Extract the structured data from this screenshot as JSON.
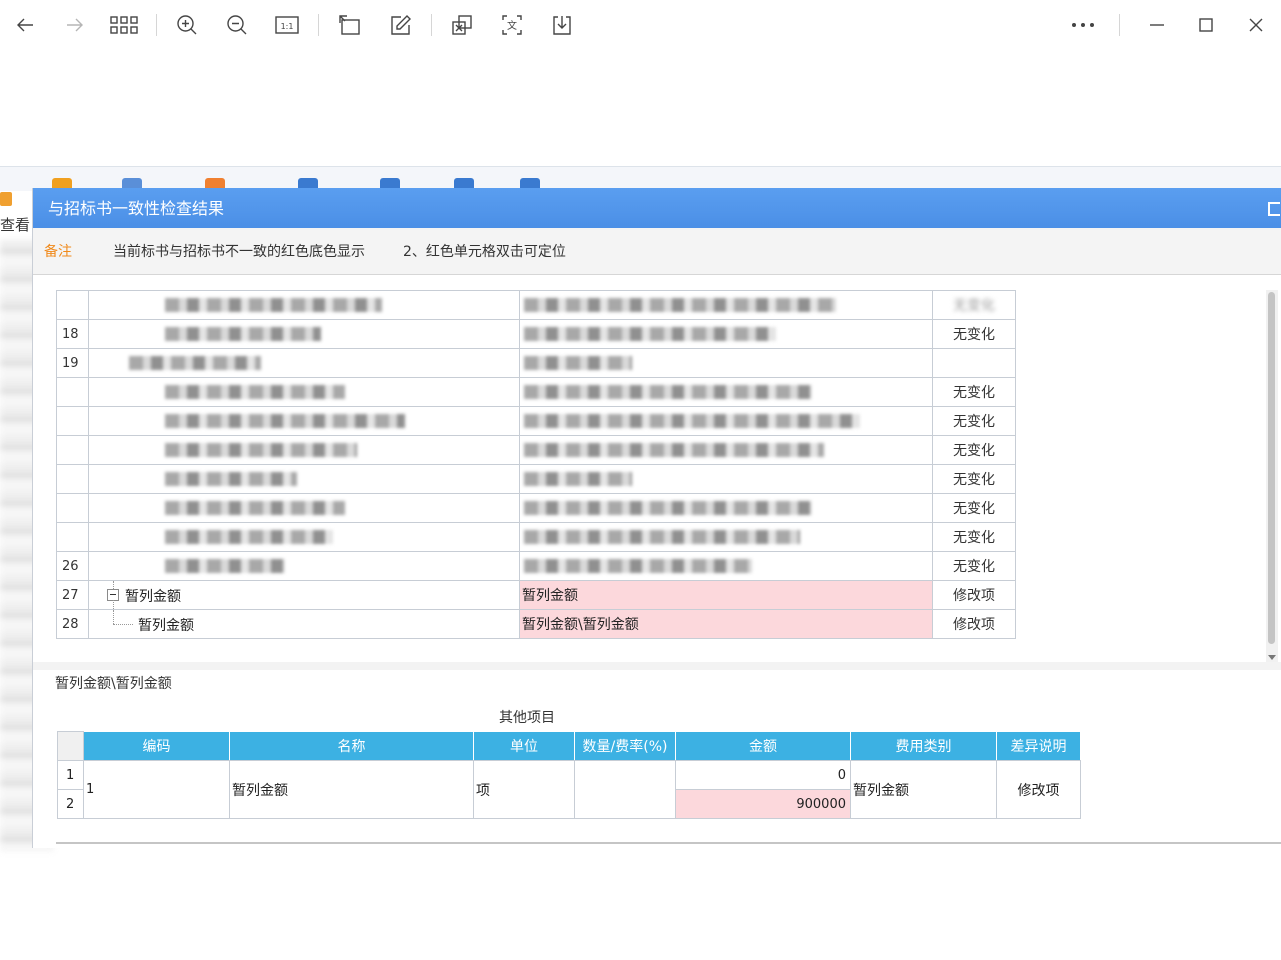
{
  "viewer": {
    "toolbar": [
      {
        "name": "back-button",
        "icon": "arrow-left-icon"
      },
      {
        "name": "forward-button",
        "icon": "arrow-right-icon"
      },
      {
        "name": "grid-view-button",
        "icon": "grid-icon"
      },
      {
        "name": "zoom-in-button",
        "icon": "zoom-in-icon"
      },
      {
        "name": "zoom-out-button",
        "icon": "zoom-out-icon"
      },
      {
        "name": "actual-size-button",
        "icon": "actual-size-icon",
        "text": "1:1"
      },
      {
        "name": "rotate-button",
        "icon": "rotate-icon"
      },
      {
        "name": "edit-button",
        "icon": "edit-icon"
      },
      {
        "name": "copy-button",
        "icon": "copy-icon"
      },
      {
        "name": "ocr-button",
        "icon": "ocr-icon",
        "text": "文"
      },
      {
        "name": "save-button",
        "icon": "download-icon"
      },
      {
        "name": "more-button",
        "icon": "more-icon"
      },
      {
        "name": "minimize-button",
        "icon": "minimize-icon"
      },
      {
        "name": "maximize-button",
        "icon": "maximize-icon"
      },
      {
        "name": "close-button",
        "icon": "close-icon"
      }
    ]
  },
  "app": {
    "left_label": "查看"
  },
  "dialog": {
    "title": "与招标书一致性检查结果",
    "note_label": "备注",
    "note_text_1": "当前标书与招标书不一致的红色底色显示",
    "note_text_2": "2、红色单元格双击可定位",
    "accent_color": "#4b8fe6",
    "highlight_color": "#fcd8dc"
  },
  "upper_grid": {
    "rows": [
      {
        "num": "",
        "col1": "",
        "col2": "",
        "status": "无变化",
        "blurred": true,
        "status_blurred": true
      },
      {
        "num": "18",
        "col1": "",
        "col2": "",
        "status": "无变化",
        "blurred": true
      },
      {
        "num": "19",
        "col1": "",
        "col2": "",
        "status": "",
        "blurred": true,
        "status_blurred": true
      },
      {
        "num": "",
        "col1": "",
        "col2": "",
        "status": "无变化",
        "blurred": true
      },
      {
        "num": "",
        "col1": "",
        "col2": "",
        "status": "无变化",
        "blurred": true
      },
      {
        "num": "",
        "col1": "",
        "col2": "",
        "status": "无变化",
        "blurred": true
      },
      {
        "num": "",
        "col1": "",
        "col2": "",
        "status": "无变化",
        "blurred": true
      },
      {
        "num": "",
        "col1": "",
        "col2": "",
        "status": "无变化",
        "blurred": true
      },
      {
        "num": "",
        "col1": "",
        "col2": "",
        "status": "无变化",
        "blurred": true
      },
      {
        "num": "26",
        "col1": "",
        "col2": "",
        "status": "无变化",
        "blurred": true
      },
      {
        "num": "27",
        "col1": "暂列金额",
        "col2": "暂列金额",
        "status": "修改项",
        "highlight": true
      },
      {
        "num": "28",
        "col1": "暂列金额",
        "col2": "暂列金额\\暂列金额",
        "status": "修改项",
        "highlight": true
      }
    ]
  },
  "lower": {
    "path_label": "暂列金额\\暂列金额",
    "section_title": "其他项目",
    "headers": [
      "编码",
      "名称",
      "单位",
      "数量/费率(%)",
      "金额",
      "费用类别",
      "差异说明"
    ],
    "row_numbers": [
      "1",
      "2"
    ],
    "code": "1",
    "name": "暂列金额",
    "unit": "项",
    "qty": "",
    "amount_old": "0",
    "amount_new": "900000",
    "fee_type": "暂列金额",
    "diff": "修改项"
  }
}
